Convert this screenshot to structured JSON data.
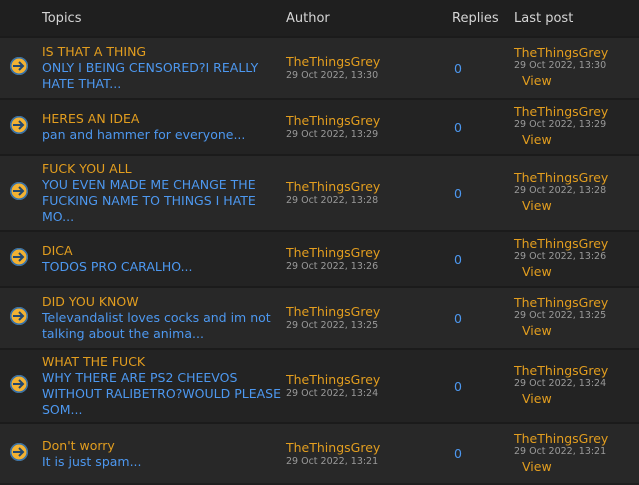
{
  "header": {
    "topics": "Topics",
    "author": "Author",
    "replies": "Replies",
    "last_post": "Last post"
  },
  "colors": {
    "title": "#e39e1f",
    "preview": "#4d98f0",
    "date": "#9a9a9a",
    "row_a": "#282828",
    "row_b": "#232323"
  },
  "topic_icon": "arrow-right-circle-icon",
  "rows": [
    {
      "title": "IS THAT A THING",
      "preview": "ONLY I BEING CENSORED?I REALLY HATE THAT...",
      "author": "TheThingsGrey",
      "date": "29 Oct 2022, 13:30",
      "replies": "0",
      "last_author": "TheThingsGrey",
      "last_date": "29 Oct 2022, 13:30",
      "view": "View"
    },
    {
      "title": "HERES AN IDEA",
      "preview": "pan and hammer for everyone...",
      "author": "TheThingsGrey",
      "date": "29 Oct 2022, 13:29",
      "replies": "0",
      "last_author": "TheThingsGrey",
      "last_date": "29 Oct 2022, 13:29",
      "view": "View"
    },
    {
      "title": "FUCK YOU ALL",
      "preview": "YOU EVEN MADE ME CHANGE THE FUCKING NAME TO THINGS I HATE MO...",
      "author": "TheThingsGrey",
      "date": "29 Oct 2022, 13:28",
      "replies": "0",
      "last_author": "TheThingsGrey",
      "last_date": "29 Oct 2022, 13:28",
      "view": "View"
    },
    {
      "title": "DICA",
      "preview": "TODOS PRO CARALHO...",
      "author": "TheThingsGrey",
      "date": "29 Oct 2022, 13:26",
      "replies": "0",
      "last_author": "TheThingsGrey",
      "last_date": "29 Oct 2022, 13:26",
      "view": "View"
    },
    {
      "title": "DID YOU KNOW",
      "preview": "Televandalist loves cocks and im not talking about the anima...",
      "author": "TheThingsGrey",
      "date": "29 Oct 2022, 13:25",
      "replies": "0",
      "last_author": "TheThingsGrey",
      "last_date": "29 Oct 2022, 13:25",
      "view": "View"
    },
    {
      "title": "WHAT THE FUCK",
      "preview": "WHY THERE ARE PS2 CHEEVOS WITHOUT RALIBETRO?WOULD PLEASE SOM...",
      "author": "TheThingsGrey",
      "date": "29 Oct 2022, 13:24",
      "replies": "0",
      "last_author": "TheThingsGrey",
      "last_date": "29 Oct 2022, 13:24",
      "view": "View"
    },
    {
      "title": "Don't worry",
      "preview": "It is just spam...",
      "author": "TheThingsGrey",
      "date": "29 Oct 2022, 13:21",
      "replies": "0",
      "last_author": "TheThingsGrey",
      "last_date": "29 Oct 2022, 13:21",
      "view": "View"
    }
  ]
}
